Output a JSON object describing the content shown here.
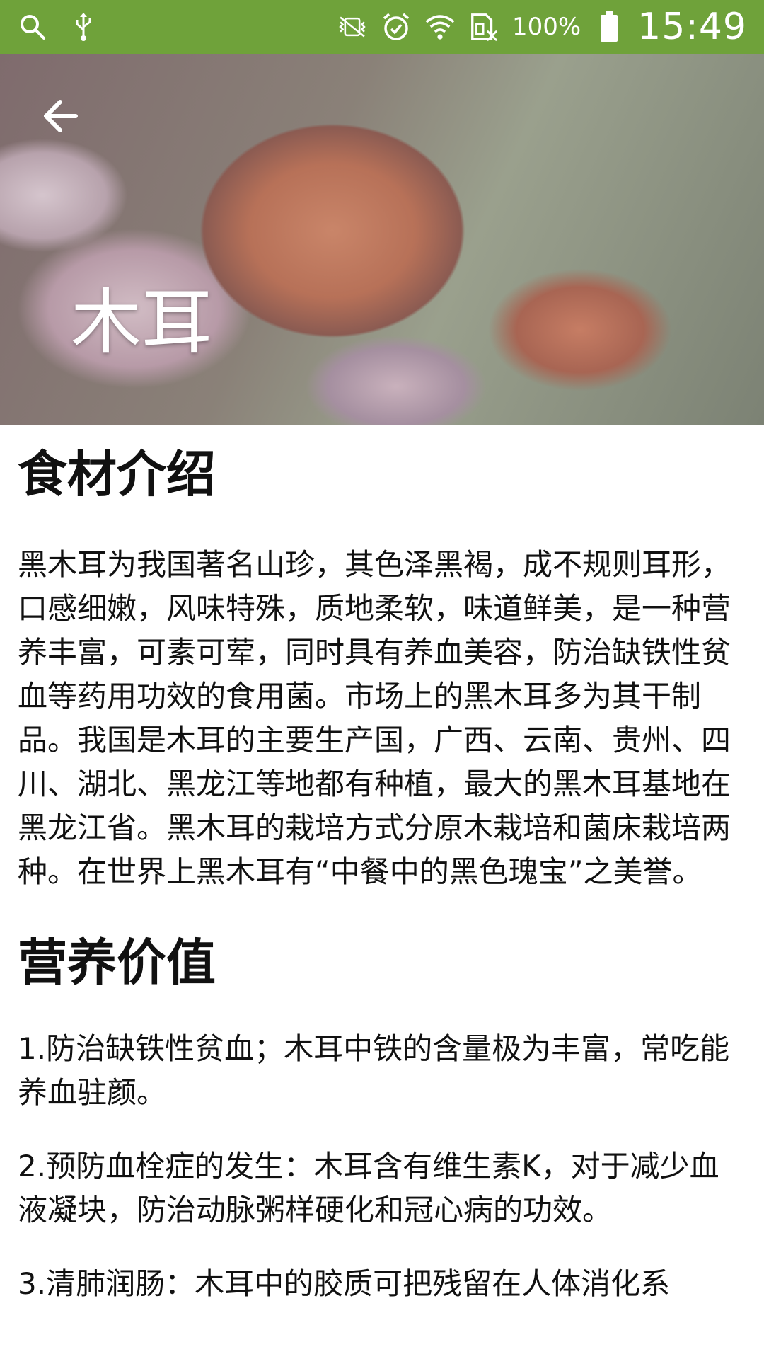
{
  "status_bar": {
    "battery_percent": "100%",
    "time": "15:49",
    "icons": [
      "search-icon",
      "usb-icon",
      "vibrate-off-icon",
      "alarm-icon",
      "wifi-icon",
      "sim-off-icon",
      "battery-icon"
    ],
    "bg_color": "#6fa23a"
  },
  "header": {
    "title": "木耳",
    "back_icon": "back-arrow-icon"
  },
  "sections": {
    "intro": {
      "title": "食材介绍",
      "text": "黑木耳为我国著名山珍，其色泽黑褐，成不规则耳形，口感细嫩，风味特殊，质地柔软，味道鲜美，是一种营养丰富，可素可荤，同时具有养血美容，防治缺铁性贫血等药用功效的食用菌。市场上的黑木耳多为其干制品。我国是木耳的主要生产国，广西、云南、贵州、四川、湖北、黑龙江等地都有种植，最大的黑木耳基地在黑龙江省。黑木耳的栽培方式分原木栽培和菌床栽培两种。在世界上黑木耳有“中餐中的黑色瑰宝”之美誉。"
    },
    "nutrition": {
      "title": "营养价值",
      "items": [
        "1.防治缺铁性贫血；木耳中铁的含量极为丰富，常吃能养血驻颜。",
        "2.预防血栓症的发生：木耳含有维生素K，对于减少血液凝块，防治动脉粥样硬化和冠心病的功效。",
        "3.清肺润肠：木耳中的胶质可把残留在人体消化系"
      ]
    }
  }
}
